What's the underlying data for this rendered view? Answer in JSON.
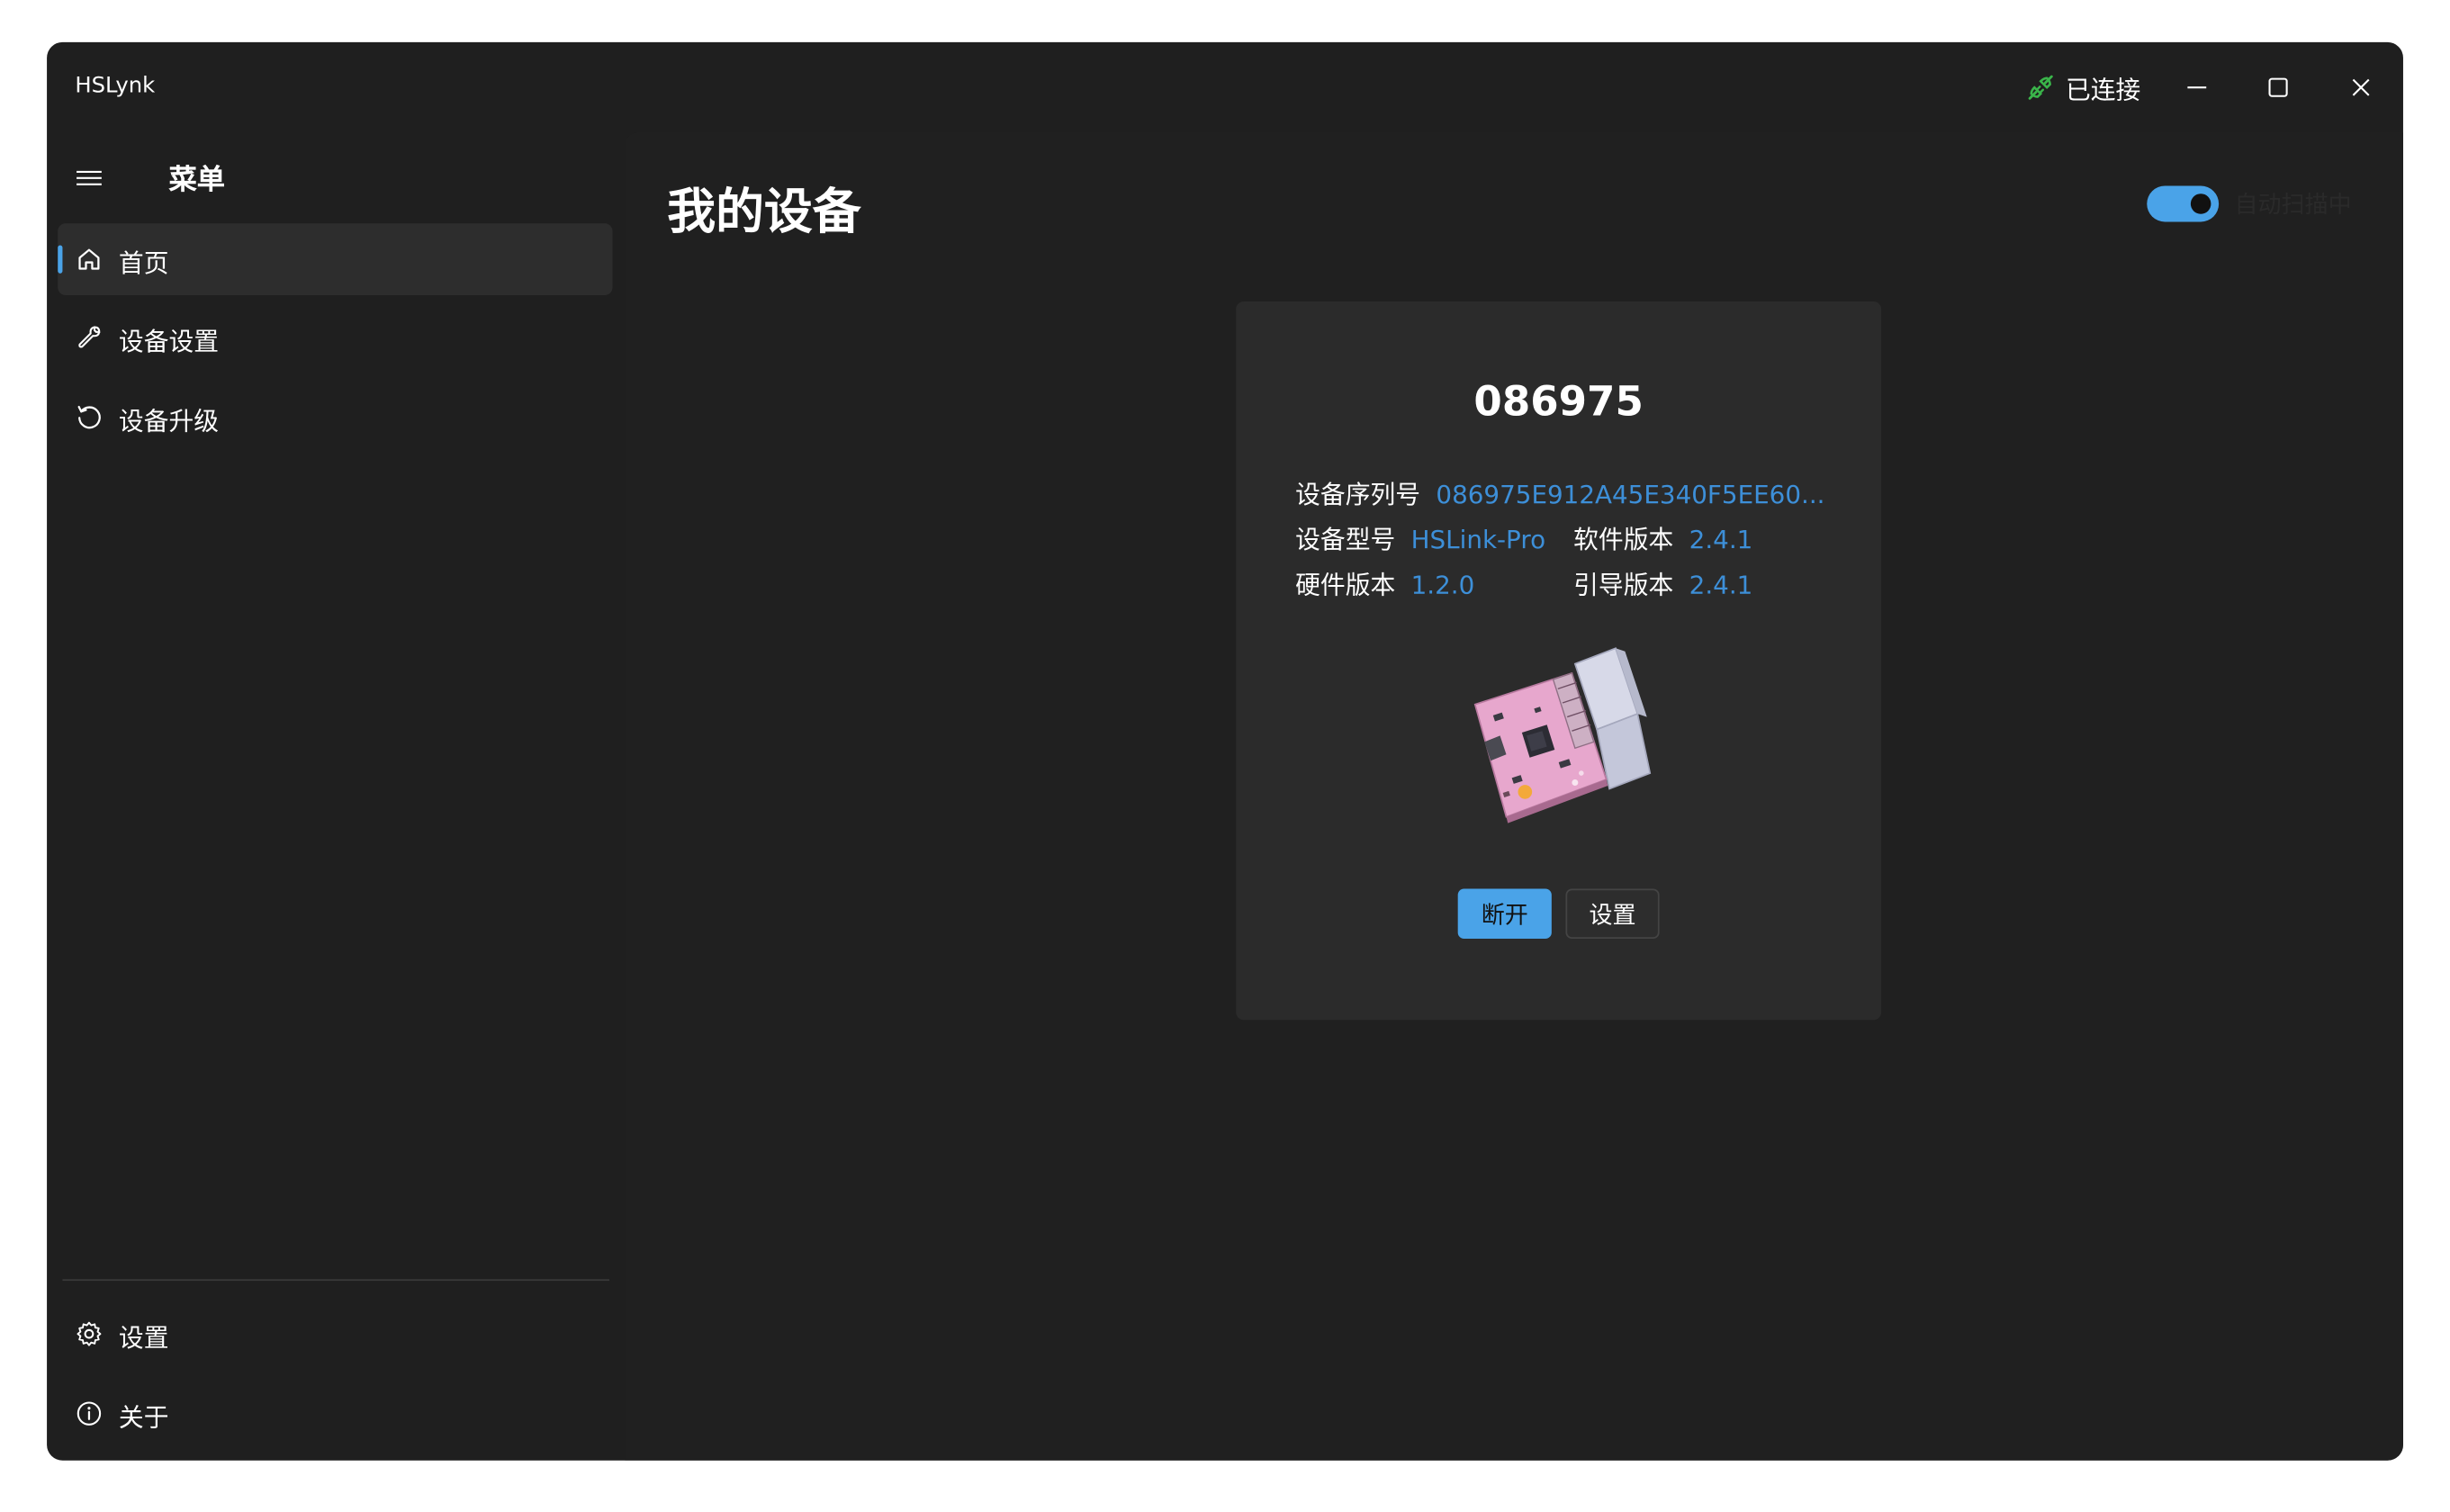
{
  "window": {
    "title": "HSLynk",
    "status": "已连接",
    "status_color": "#3ab54a",
    "controls": [
      "minimize-icon",
      "maximize-icon",
      "close-icon"
    ]
  },
  "sidebar": {
    "title": "菜单",
    "items": [
      {
        "label": "首页",
        "icon": "home-icon",
        "selected": true
      },
      {
        "label": "设备设置",
        "icon": "wrench-icon",
        "selected": false
      },
      {
        "label": "设备升级",
        "icon": "refresh-icon",
        "selected": false
      }
    ],
    "footer_items": [
      {
        "label": "设置",
        "icon": "gear-icon"
      },
      {
        "label": "关于",
        "icon": "info-icon"
      }
    ]
  },
  "main": {
    "title": "我的设备",
    "auto_scan": {
      "label": "自动扫描中",
      "enabled": true
    },
    "device": {
      "name": "086975",
      "serial_label": "设备序列号",
      "serial_value": "086975E912A45E340F5EE60...",
      "model_label": "设备型号",
      "model_value": "HSLink-Pro",
      "software_label": "软件版本",
      "software_value": "2.4.1",
      "hardware_label": "硬件版本",
      "hardware_value": "1.2.0",
      "bootloader_label": "引导版本",
      "bootloader_value": "2.4.1",
      "image": "device-board-icon",
      "disconnect_label": "断开",
      "settings_label": "设置"
    }
  },
  "colors": {
    "accent": "#4aa3e8",
    "link": "#3d8fd8",
    "window_bg": "#1f1f1f",
    "card_bg": "#2b2b2b"
  }
}
